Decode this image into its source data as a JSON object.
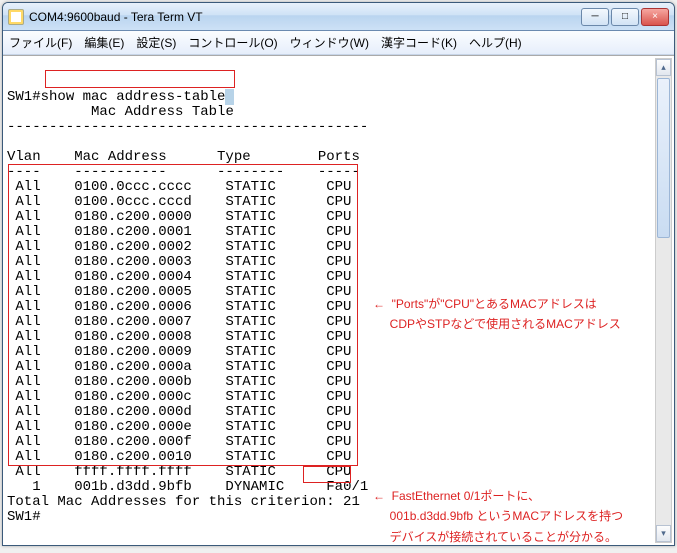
{
  "window": {
    "title": "COM4:9600baud - Tera Term VT",
    "min_label": "─",
    "max_label": "□",
    "close_label": "×"
  },
  "menu": {
    "file": "ファイル(F)",
    "edit": "編集(E)",
    "setup": "設定(S)",
    "control": "コントロール(O)",
    "window": "ウィンドウ(W)",
    "kanji": "漢字コード(K)",
    "help": "ヘルプ(H)"
  },
  "scrollbar": {
    "up": "▴",
    "down": "▾"
  },
  "term": {
    "prompt1": "SW1#",
    "cmd": "show mac address-table",
    "cursor": " ",
    "title_indent": "          ",
    "title": "Mac Address Table",
    "title_dash": "-------------------------------------------",
    "blank": "",
    "hdr": "Vlan    Mac Address      Type        Ports",
    "hdr2": "----    -----------      --------    -----",
    "rows": [
      " All    0100.0ccc.cccc    STATIC      CPU",
      " All    0100.0ccc.cccd    STATIC      CPU",
      " All    0180.c200.0000    STATIC      CPU",
      " All    0180.c200.0001    STATIC      CPU",
      " All    0180.c200.0002    STATIC      CPU",
      " All    0180.c200.0003    STATIC      CPU",
      " All    0180.c200.0004    STATIC      CPU",
      " All    0180.c200.0005    STATIC      CPU",
      " All    0180.c200.0006    STATIC      CPU",
      " All    0180.c200.0007    STATIC      CPU",
      " All    0180.c200.0008    STATIC      CPU",
      " All    0180.c200.0009    STATIC      CPU",
      " All    0180.c200.000a    STATIC      CPU",
      " All    0180.c200.000b    STATIC      CPU",
      " All    0180.c200.000c    STATIC      CPU",
      " All    0180.c200.000d    STATIC      CPU",
      " All    0180.c200.000e    STATIC      CPU",
      " All    0180.c200.000f    STATIC      CPU",
      " All    0180.c200.0010    STATIC      CPU",
      " All    ffff.ffff.ffff    STATIC      CPU"
    ],
    "row_dynamic_left": "   1    001b.d3dd.9bfb    DYNAMIC     ",
    "row_dynamic_port": "Fa0/1",
    "total": "Total Mac Addresses for this criterion: 21",
    "prompt2": "SW1#"
  },
  "annot": {
    "a1_arrow": "←",
    "a1_l1": "\"Ports\"が\"CPU\"とあるMACアドレスは",
    "a1_l2": "CDPやSTPなどで使用されるMACアドレス",
    "a2_arrow": "←",
    "a2_l1": "FastEthernet 0/1ポートに、",
    "a2_l2": "001b.d3dd.9bfb というMACアドレスを持つ",
    "a2_l3": "デバイスが接続されていることが分かる。"
  }
}
